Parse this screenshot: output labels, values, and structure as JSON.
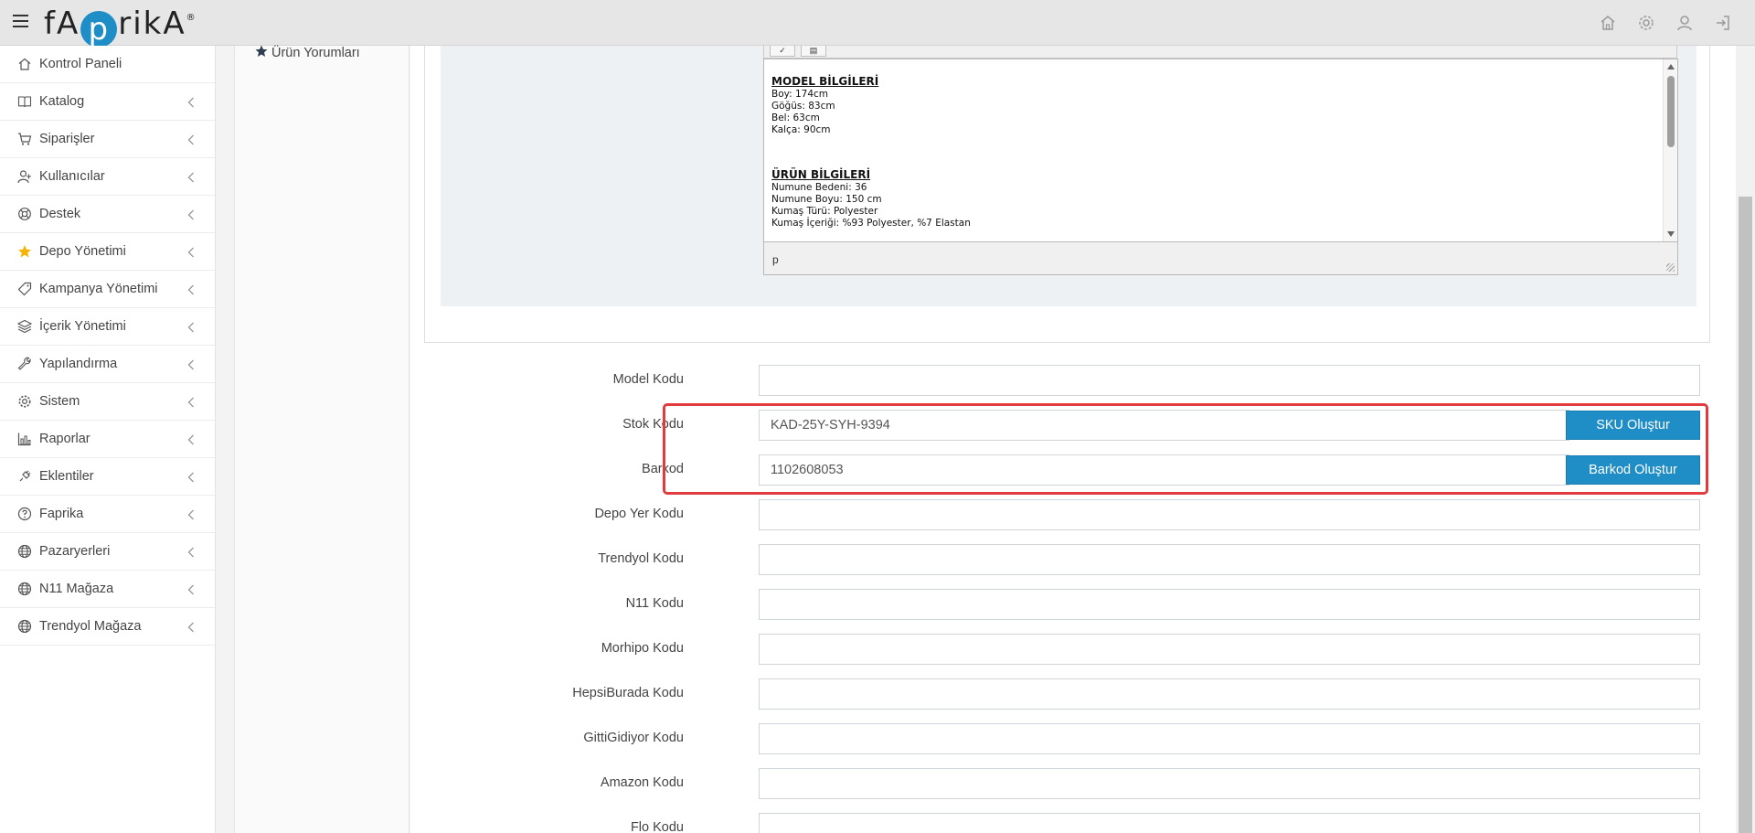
{
  "app": {
    "logo_text_1": "fA",
    "logo_p": "p",
    "logo_text_2": "rikA",
    "logo_reg": "®"
  },
  "topbar": {
    "icons": [
      "home-icon",
      "gear-icon",
      "user-icon",
      "logout-icon"
    ]
  },
  "sidebar": {
    "items": [
      {
        "label": "Kontrol Paneli",
        "icon": "home-icon",
        "has_chevron": false
      },
      {
        "label": "Katalog",
        "icon": "book-icon",
        "has_chevron": true
      },
      {
        "label": "Siparişler",
        "icon": "cart-icon",
        "has_chevron": true
      },
      {
        "label": "Kullanıcılar",
        "icon": "users-icon",
        "has_chevron": true
      },
      {
        "label": "Destek",
        "icon": "lifebuoy-icon",
        "has_chevron": true
      },
      {
        "label": "Depo Yönetimi",
        "icon": "star-icon",
        "has_chevron": true
      },
      {
        "label": "Kampanya Yönetimi",
        "icon": "tag-icon",
        "has_chevron": true
      },
      {
        "label": "İçerik Yönetimi",
        "icon": "layers-icon",
        "has_chevron": true
      },
      {
        "label": "Yapılandırma",
        "icon": "wrench-icon",
        "has_chevron": true
      },
      {
        "label": "Sistem",
        "icon": "cog-icon",
        "has_chevron": true
      },
      {
        "label": "Raporlar",
        "icon": "chart-icon",
        "has_chevron": true
      },
      {
        "label": "Eklentiler",
        "icon": "plugin-icon",
        "has_chevron": true
      },
      {
        "label": "Faprika",
        "icon": "question-icon",
        "has_chevron": true
      },
      {
        "label": "Pazaryerleri",
        "icon": "globe-icon",
        "has_chevron": true
      },
      {
        "label": "N11 Mağaza",
        "icon": "globe-icon",
        "has_chevron": true
      },
      {
        "label": "Trendyol Mağaza",
        "icon": "globe-icon",
        "has_chevron": true
      }
    ],
    "accent_star_color": "#f5b400"
  },
  "subpanel": {
    "item_label": "Ürün Yorumları"
  },
  "editor": {
    "sections": [
      {
        "title": "MODEL BİLGİLERİ",
        "lines": [
          "Boy: 174cm",
          "Göğüs: 83cm",
          "Bel: 63cm",
          "Kalça: 90cm"
        ]
      },
      {
        "title": "ÜRÜN BİLGİLERİ",
        "lines": [
          "Numune Bedeni: 36",
          "Numune Boyu: 150  cm",
          "Kumaş Türü: Polyester",
          "Kumaş İçeriği: %93 Polyester, %7 Elastan"
        ]
      }
    ],
    "status_path": "p"
  },
  "form": {
    "model_kodu": {
      "label": "Model Kodu",
      "value": ""
    },
    "stok_kodu": {
      "label": "Stok Kodu",
      "value": "KAD-25Y-SYH-9394",
      "button": "SKU Oluştur"
    },
    "barkod": {
      "label": "Barkod",
      "value": "1102608053",
      "button": "Barkod Oluştur"
    },
    "depo_yer_kodu": {
      "label": "Depo Yer Kodu",
      "value": ""
    },
    "trendyol_kodu": {
      "label": "Trendyol Kodu",
      "value": ""
    },
    "n11_kodu": {
      "label": "N11 Kodu",
      "value": ""
    },
    "morhipo_kodu": {
      "label": "Morhipo Kodu",
      "value": ""
    },
    "hepsiburada_kodu": {
      "label": "HepsiBurada Kodu",
      "value": ""
    },
    "gittigidiyor_kodu": {
      "label": "GittiGidiyor Kodu",
      "value": ""
    },
    "amazon_kodu": {
      "label": "Amazon Kodu",
      "value": ""
    },
    "flo_kodu": {
      "label": "Flo Kodu",
      "value": ""
    }
  },
  "colors": {
    "primary": "#1f8dc6",
    "highlight": "#e03b3f"
  }
}
